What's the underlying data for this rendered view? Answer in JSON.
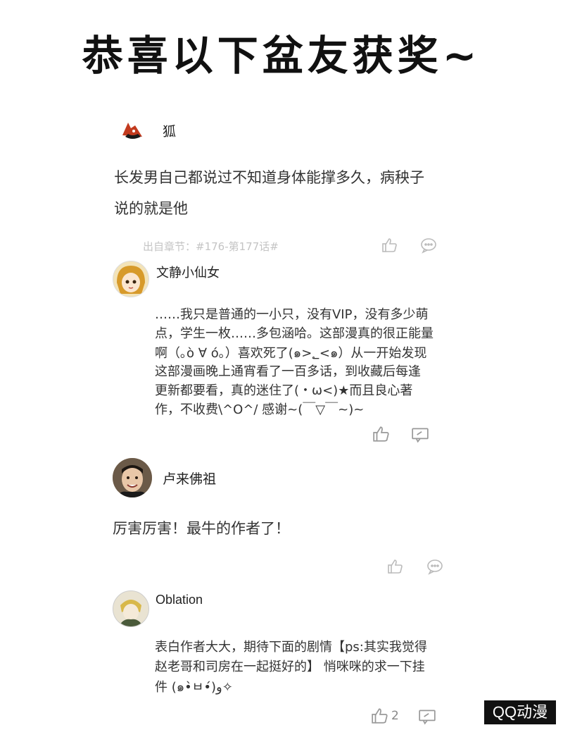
{
  "title": "恭喜以下盆友获奖~",
  "comments": [
    {
      "username": "狐",
      "lines": [
        "长发男自己都说过不知道身体能撑多久，病秧子",
        "说的就是他"
      ],
      "chapter": "出自章节：#176-第177话#"
    },
    {
      "username": "文静小仙女",
      "lines": [
        "……我只是普通的一小只，没有VIP，没有多少萌",
        "点，学生一枚……多包涵哈。这部漫真的很正能量",
        "啊（｡ò ∀ ó｡）喜欢死了(๑>؂<๑）从一开始发现",
        "这部漫画晚上通宵看了一百多话，到收藏后每逢",
        "更新都要看，真的迷住了(・ω<)★而且良心著",
        "作，不收费\\^O^/ 感谢~(￣▽￣~)~"
      ]
    },
    {
      "username": "卢来佛祖",
      "lines": [
        "厉害厉害！最牛的作者了！"
      ]
    },
    {
      "username": "Oblation",
      "lines": [
        "表白作者大大，期待下面的剧情【ps:其实我觉得",
        "赵老哥和司房在一起挺好的】 悄咪咪的求一下挂",
        "件 (๑•̀ㅂ•́)و✧"
      ],
      "like_count": "2"
    }
  ],
  "watermark": "QQ动漫",
  "icons": [
    "fox-avatar",
    "like-icon",
    "comment-icon",
    "reply-icon"
  ]
}
